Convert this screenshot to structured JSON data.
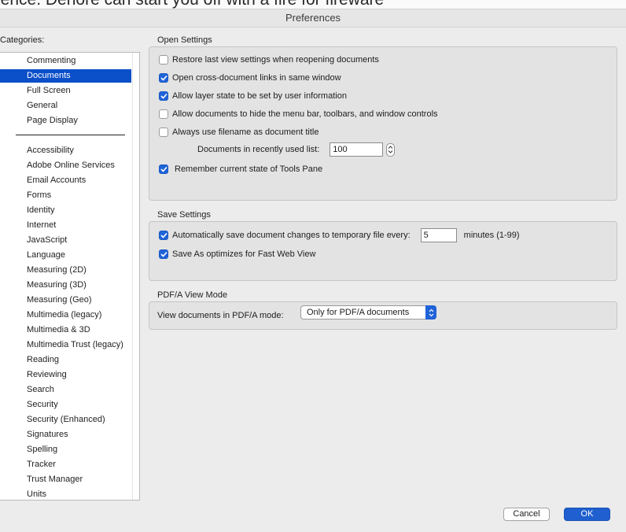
{
  "background": {
    "partial_text": "ience. Denore can start you off with a fire for fireware"
  },
  "window": {
    "title": "Preferences"
  },
  "sidebar": {
    "label": "Categories:",
    "selected": "Documents",
    "top_items": [
      "Commenting",
      "Documents",
      "Full Screen",
      "General",
      "Page Display"
    ],
    "items": [
      "Accessibility",
      "Adobe Online Services",
      "Email Accounts",
      "Forms",
      "Identity",
      "Internet",
      "JavaScript",
      "Language",
      "Measuring (2D)",
      "Measuring (3D)",
      "Measuring (Geo)",
      "Multimedia (legacy)",
      "Multimedia & 3D",
      "Multimedia Trust (legacy)",
      "Reading",
      "Reviewing",
      "Search",
      "Security",
      "Security (Enhanced)",
      "Signatures",
      "Spelling",
      "Tracker",
      "Trust Manager",
      "Units"
    ]
  },
  "open_settings": {
    "title": "Open Settings",
    "options": [
      {
        "label": "Restore last view settings when reopening documents",
        "checked": false
      },
      {
        "label": "Open cross-document links in same window",
        "checked": true
      },
      {
        "label": "Allow layer state to be set by user information",
        "checked": true
      },
      {
        "label": "Allow documents to hide the menu bar, toolbars, and window controls",
        "checked": false
      },
      {
        "label": "Always use filename as document title",
        "checked": false
      }
    ],
    "recent_list_label": "Documents in recently used list:",
    "recent_list_value": "100",
    "tools_pane": {
      "label": "Remember current state of Tools Pane",
      "checked": true
    }
  },
  "save_settings": {
    "title": "Save Settings",
    "autosave": {
      "label": "Automatically save document changes to temporary file every:",
      "checked": true,
      "value": "5",
      "suffix": "minutes (1-99)"
    },
    "fast_web": {
      "label": "Save As optimizes for Fast Web View",
      "checked": true
    }
  },
  "pdfa": {
    "title": "PDF/A View Mode",
    "label": "View documents in PDF/A mode:",
    "selected": "Only for PDF/A documents"
  },
  "buttons": {
    "cancel": "Cancel",
    "ok": "OK"
  },
  "colors": {
    "selection": "#0b4fc9",
    "checkbox": "#1f63d8",
    "ok_button": "#1f5fcf"
  }
}
